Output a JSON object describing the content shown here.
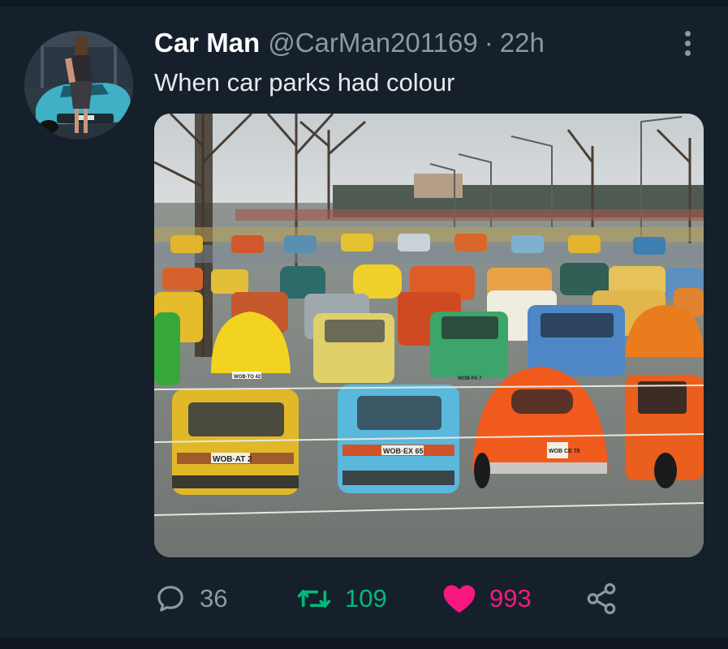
{
  "tweet": {
    "display_name": "Car Man",
    "handle": "@CarMan201169",
    "separator": "·",
    "time": "22h",
    "text": "When car parks had colour"
  },
  "media": {
    "plates": [
      "WOB·AT 2",
      "WOB·EX 65",
      "WOB CE 78",
      "WOB·TO 42",
      "WOB·PA 7"
    ]
  },
  "actions": {
    "replies": "36",
    "retweets": "109",
    "likes": "993"
  },
  "colors": {
    "background": "#15202b",
    "retweet": "#00ba7c",
    "like": "#f91880",
    "secondary_text": "#8b98a5"
  },
  "icons": [
    "reply-icon",
    "retweet-icon",
    "heart-icon",
    "share-icon",
    "more-options-icon"
  ]
}
